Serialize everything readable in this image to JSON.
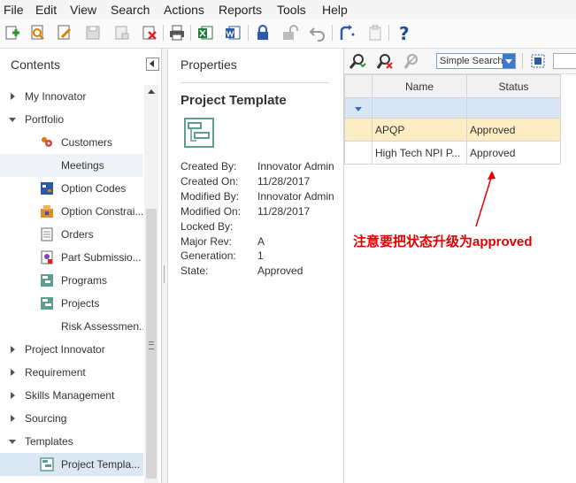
{
  "menu": [
    "File",
    "Edit",
    "View",
    "Search",
    "Actions",
    "Reports",
    "Tools",
    "Help"
  ],
  "toolbar_icons": [
    "new-icon",
    "search-icon",
    "edit-icon",
    "save-icon",
    "save-close-icon",
    "delete-icon",
    "print-icon",
    "excel-icon",
    "word-icon",
    "lock-icon",
    "unlock-icon",
    "undo-icon",
    "promote-icon",
    "clipboard-icon",
    "help-icon"
  ],
  "contents": {
    "title": "Contents",
    "items": [
      {
        "label": "My Innovator",
        "level": 0,
        "expanded": false
      },
      {
        "label": "Portfolio",
        "level": 0,
        "expanded": true
      },
      {
        "label": "Customers",
        "level": 1,
        "icon": "customers-icon"
      },
      {
        "label": "Meetings",
        "level": 1,
        "icon": ""
      },
      {
        "label": "Option Codes",
        "level": 1,
        "icon": "option-codes-icon"
      },
      {
        "label": "Option Constrai...",
        "level": 1,
        "icon": "option-constraints-icon"
      },
      {
        "label": "Orders",
        "level": 1,
        "icon": "orders-icon"
      },
      {
        "label": "Part Submissio...",
        "level": 1,
        "icon": "part-submission-icon"
      },
      {
        "label": "Programs",
        "level": 1,
        "icon": "programs-icon"
      },
      {
        "label": "Projects",
        "level": 1,
        "icon": "projects-icon"
      },
      {
        "label": "Risk Assessmen...",
        "level": 1,
        "icon": ""
      },
      {
        "label": "Project Innovator",
        "level": 0,
        "expanded": false
      },
      {
        "label": "Requirement",
        "level": 0,
        "expanded": false
      },
      {
        "label": "Skills Management",
        "level": 0,
        "expanded": false
      },
      {
        "label": "Sourcing",
        "level": 0,
        "expanded": false
      },
      {
        "label": "Templates",
        "level": 0,
        "expanded": true
      },
      {
        "label": "Project Templa...",
        "level": 1,
        "icon": "project-template-icon",
        "selected": true
      }
    ]
  },
  "properties": {
    "title": "Properties",
    "heading": "Project Template",
    "fields": [
      {
        "label": "Created By:",
        "value": "Innovator Admin"
      },
      {
        "label": "Created On:",
        "value": "11/28/2017"
      },
      {
        "label": "Modified By:",
        "value": "Innovator Admin"
      },
      {
        "label": "Modified On:",
        "value": "11/28/2017"
      },
      {
        "label": "Locked By:",
        "value": ""
      },
      {
        "label": "Major Rev:",
        "value": "A"
      },
      {
        "label": "Generation:",
        "value": "1"
      },
      {
        "label": "State:",
        "value": "Approved"
      }
    ]
  },
  "grid": {
    "search_mode": "Simple Search",
    "columns": [
      "Name",
      "Status"
    ],
    "rows": [
      {
        "name": "APQP",
        "status": "Approved"
      },
      {
        "name": "High Tech NPI P...",
        "status": "Approved"
      }
    ]
  },
  "annotation": "注意要把状态升级为approved",
  "colors": {
    "accent": "#3d78c9",
    "selected_row": "#fcedc4",
    "annotation": "#e00000",
    "tree_selected": "#dce7f4"
  }
}
